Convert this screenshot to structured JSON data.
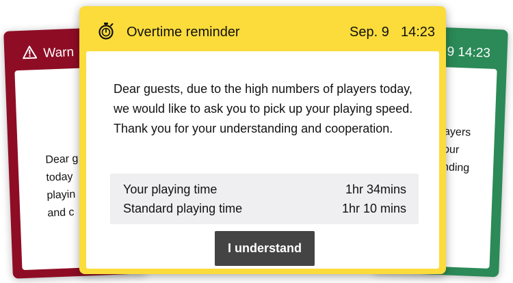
{
  "cards": {
    "warning": {
      "title": "Warn",
      "icon": "warning-triangle-icon",
      "color": "#8e0d25",
      "body_lines": "Dear g\ntoday\nplayin\nand c"
    },
    "info": {
      "datetime": "9  14:23",
      "color": "#2b8a57",
      "body_lines": "ayers\nour\nnding"
    },
    "reminder": {
      "color": "#fbdc3b",
      "icon": "stopwatch-icon",
      "title": "Overtime reminder",
      "date": "Sep. 9",
      "time": "14:23",
      "message": "Dear guests, due to the high numbers of players today, we would like to ask you to pick up your playing speed. Thank you for your understanding and cooperation.",
      "table": [
        {
          "label": "Your playing time",
          "value": "1hr 34mins"
        },
        {
          "label": "Standard playing time",
          "value": "1hr 10 mins"
        }
      ],
      "button_label": "I understand"
    }
  }
}
